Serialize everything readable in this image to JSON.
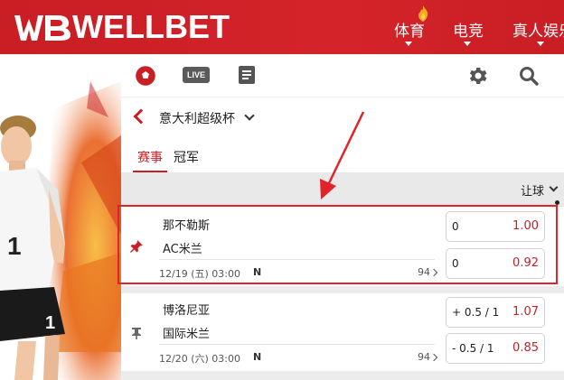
{
  "header": {
    "brand": "WELLBET",
    "nav": [
      {
        "label": "体育"
      },
      {
        "label": "电竞"
      },
      {
        "label": "真人娱乐"
      }
    ]
  },
  "toolbar": {
    "live_label": "LIVE",
    "icons": [
      "soccer-ball-icon",
      "live-icon",
      "document-icon",
      "gear-icon",
      "search-icon"
    ]
  },
  "league": {
    "name": "意大利超级杯"
  },
  "tabs": [
    {
      "label": "赛事",
      "active": true
    },
    {
      "label": "冠军",
      "active": false
    }
  ],
  "market": {
    "label": "让球"
  },
  "matches": [
    {
      "home": "那不勒斯",
      "away": "AC米兰",
      "date": "12/19 (五) 03:00",
      "n": "N",
      "more": "94",
      "pinned": true,
      "odds": [
        {
          "hdp": "0",
          "value": "1.00"
        },
        {
          "hdp": "0",
          "value": "0.92"
        }
      ]
    },
    {
      "home": "博洛尼亚",
      "away": "国际米兰",
      "date": "12/20 (六) 03:00",
      "n": "N",
      "more": "94",
      "pinned": false,
      "odds": [
        {
          "hdp": "+ 0.5 / 1",
          "value": "1.07"
        },
        {
          "hdp": "- 0.5 / 1",
          "value": "0.85"
        }
      ]
    }
  ],
  "colors": {
    "brand_red": "#c81e24",
    "odds_red": "#c81e24",
    "highlight": "#e0242a"
  }
}
